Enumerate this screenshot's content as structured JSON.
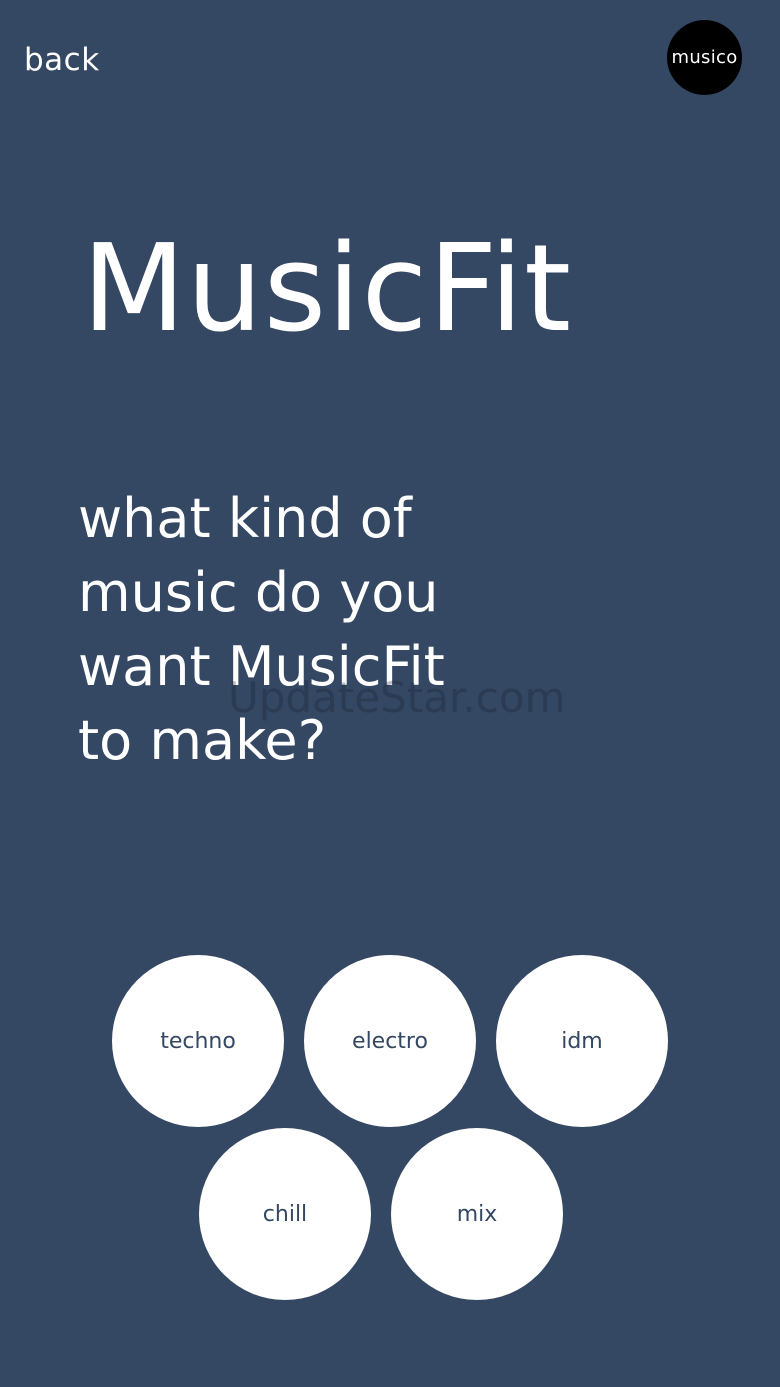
{
  "header": {
    "back_label": "back",
    "brand_label": "musico"
  },
  "app_title": "MusicFit",
  "question": "what kind of\nmusic do you\nwant MusicFit\nto make?",
  "watermark": "UpdateStar.com",
  "genres": [
    {
      "label": "techno"
    },
    {
      "label": "electro"
    },
    {
      "label": "idm"
    },
    {
      "label": "chill"
    },
    {
      "label": "mix"
    }
  ],
  "colors": {
    "background": "#344763",
    "text": "#ffffff",
    "badge": "#000000",
    "option_fill": "#ffffff",
    "option_text": "#344763"
  }
}
